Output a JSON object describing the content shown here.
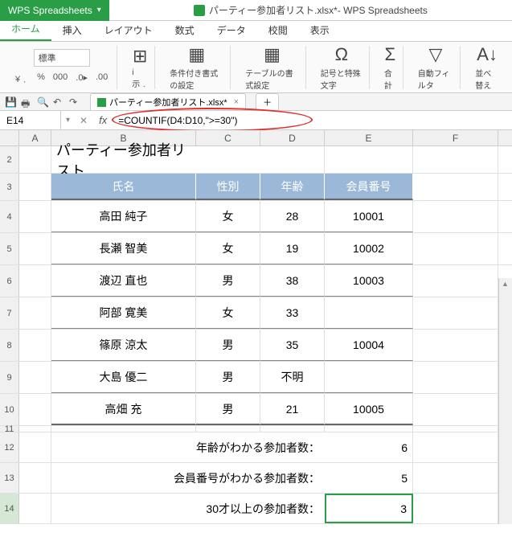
{
  "app": {
    "name": "WPS Spreadsheets",
    "window_title_doc": "パーティー参加者リスト.xlsx*",
    "window_title_suffix": " - WPS Spreadsheets"
  },
  "tabs": {
    "items": [
      "ホーム",
      "挿入",
      "レイアウト",
      "数式",
      "データ",
      "校閲",
      "表示"
    ],
    "active": 0
  },
  "ribbon": {
    "number_format": "標準",
    "cond_format": "条件付き書式の設定",
    "table_style": "テーブルの書式設定",
    "symbol": "記号と特殊文字",
    "sum": "合計",
    "filter": "自動フィルタ",
    "sort": "並べ替え"
  },
  "doc_tab": {
    "name": "パーティー参加者リスト.xlsx*"
  },
  "name_box": {
    "ref": "E14"
  },
  "formula_bar": {
    "text": "=COUNTIF(D4:D10,\">=30\")"
  },
  "columns": [
    "A",
    "B",
    "C",
    "D",
    "E",
    "F"
  ],
  "sheet": {
    "title": "パーティー参加者リスト",
    "headers": {
      "name": "氏名",
      "gender": "性別",
      "age": "年齢",
      "member_no": "会員番号"
    },
    "rows": [
      {
        "name": "高田 純子",
        "gender": "女",
        "age": "28",
        "member_no": "10001"
      },
      {
        "name": "長瀬 智美",
        "gender": "女",
        "age": "19",
        "member_no": "10002"
      },
      {
        "name": "渡辺 直也",
        "gender": "男",
        "age": "38",
        "member_no": "10003"
      },
      {
        "name": "阿部 寛美",
        "gender": "女",
        "age": "33",
        "member_no": ""
      },
      {
        "name": "篠原 涼太",
        "gender": "男",
        "age": "35",
        "member_no": "10004"
      },
      {
        "name": "大島 優二",
        "gender": "男",
        "age": "不明",
        "member_no": ""
      },
      {
        "name": "高畑 充",
        "gender": "男",
        "age": "21",
        "member_no": "10005"
      }
    ],
    "summaries": [
      {
        "label": "年齢がわかる参加者数：",
        "value": "6"
      },
      {
        "label": "会員番号がわかる参加者数：",
        "value": "5"
      },
      {
        "label": "30才以上の参加者数：",
        "value": "3"
      }
    ]
  },
  "chart_data": {
    "type": "table",
    "title": "パーティー参加者リスト",
    "columns": [
      "氏名",
      "性別",
      "年齢",
      "会員番号"
    ],
    "rows": [
      [
        "高田 純子",
        "女",
        28,
        10001
      ],
      [
        "長瀬 智美",
        "女",
        19,
        10002
      ],
      [
        "渡辺 直也",
        "男",
        38,
        10003
      ],
      [
        "阿部 寛美",
        "女",
        33,
        null
      ],
      [
        "篠原 涼太",
        "男",
        35,
        10004
      ],
      [
        "大島 優二",
        "男",
        "不明",
        null
      ],
      [
        "高畑 充",
        "男",
        21,
        10005
      ]
    ],
    "aggregates": {
      "count_age_known": 6,
      "count_member_no_known": 5,
      "count_age_gte_30": 3
    },
    "formula_shown": "=COUNTIF(D4:D10,\">=30\")"
  }
}
